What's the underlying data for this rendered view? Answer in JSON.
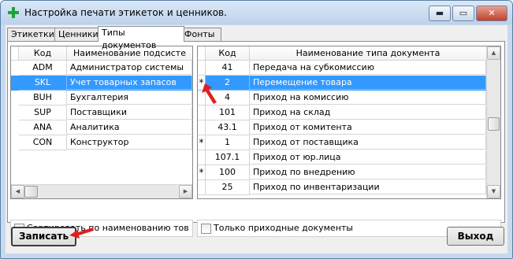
{
  "window": {
    "title": "Настройка печати этикеток и ценников.",
    "controls": {
      "minimize": "▬",
      "maximize": "▭",
      "close": "✕"
    }
  },
  "tabs": [
    {
      "label": "Этикетки",
      "active": false
    },
    {
      "label": "Ценники",
      "active": false
    },
    {
      "label": "Типы документов",
      "active": true
    },
    {
      "label": "Фонты",
      "active": false
    }
  ],
  "left_grid": {
    "headers": {
      "code": "Код",
      "name": "Наименование подсисте"
    },
    "rows": [
      {
        "code": "ADM",
        "name": "Администратор системы",
        "selected": false
      },
      {
        "code": "SKL",
        "name": "Учет товарных запасов",
        "selected": true
      },
      {
        "code": "BUH",
        "name": "Бухгалтерия",
        "selected": false
      },
      {
        "code": "SUP",
        "name": "Поставщики",
        "selected": false
      },
      {
        "code": "ANA",
        "name": "Аналитика",
        "selected": false
      },
      {
        "code": "CON",
        "name": "Конструктор",
        "selected": false
      }
    ],
    "sort_checkbox": {
      "label": "Сортировать по наименованию тов",
      "checked": false
    }
  },
  "right_grid": {
    "headers": {
      "code": "Код",
      "name": "Наименование типа документа"
    },
    "rows": [
      {
        "mark": "",
        "code": "41",
        "name": "Передача на субкомиссию",
        "selected": false
      },
      {
        "mark": "*",
        "code": "2",
        "name": "Перемещение товара",
        "selected": true
      },
      {
        "mark": "",
        "code": "4",
        "name": "Приход на комиссию",
        "selected": false
      },
      {
        "mark": "",
        "code": "101",
        "name": "Приход на склад",
        "selected": false
      },
      {
        "mark": "",
        "code": "43.1",
        "name": "Приход от комитента",
        "selected": false
      },
      {
        "mark": "*",
        "code": "1",
        "name": "Приход от поставщика",
        "selected": false
      },
      {
        "mark": "",
        "code": "107.1",
        "name": "Приход от юр.лица",
        "selected": false
      },
      {
        "mark": "*",
        "code": "100",
        "name": "Приход по внедрению",
        "selected": false
      },
      {
        "mark": "",
        "code": "25",
        "name": "Приход по инвентаризации",
        "selected": false
      }
    ],
    "incoming_checkbox": {
      "label": "Только приходные документы",
      "checked": false
    }
  },
  "buttons": {
    "save": "Записать",
    "exit": "Выход"
  },
  "colors": {
    "selection": "#3399ff",
    "annotation_arrow": "#e02020",
    "app_icon": "#1aa33a"
  }
}
